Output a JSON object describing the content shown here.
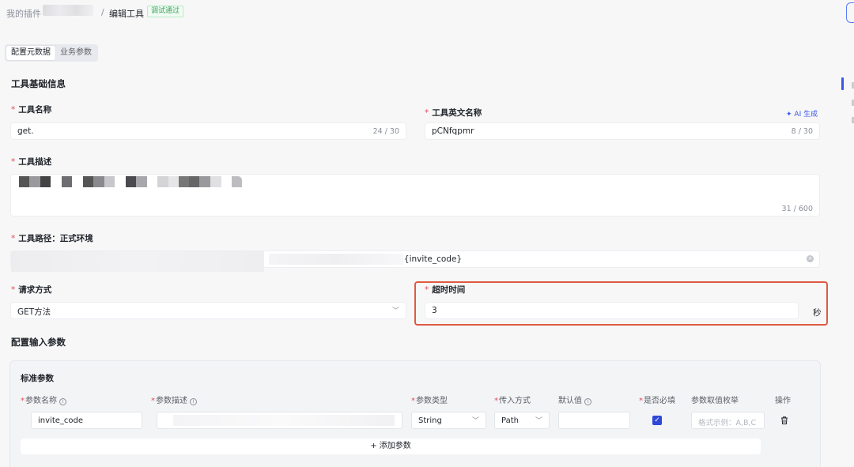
{
  "breadcrumb": {
    "root": "我的插件",
    "separator": "/",
    "current": "编辑工具",
    "status_badge": "调试通过"
  },
  "tabs": [
    {
      "label": "配置元数据",
      "active": true
    },
    {
      "label": "业务参数",
      "active": false
    }
  ],
  "basic_info": {
    "title": "工具基础信息",
    "tool_name": {
      "label": "工具名称",
      "value": "get.",
      "count": "24 / 30"
    },
    "tool_english_name": {
      "label": "工具英文名称",
      "value": "pCNfqpmr",
      "count": "8 / 30",
      "ai_generate": "AI 生成"
    },
    "tool_description": {
      "label": "工具描述",
      "count": "31 / 600"
    },
    "tool_path": {
      "label": "工具路径：正式环境",
      "value": "'{invite_code}"
    },
    "request_method": {
      "label": "请求方式",
      "value": "GET方法"
    },
    "timeout": {
      "label": "超时时间",
      "value": "3",
      "unit": "秒"
    }
  },
  "input_params": {
    "title": "配置输入参数",
    "card_title": "标准参数",
    "columns": {
      "name": "参数名称",
      "description": "参数描述",
      "type": "参数类型",
      "location": "传入方式",
      "default": "默认值",
      "required": "是否必填",
      "enum": "参数取值枚举",
      "actions": "操作"
    },
    "rows": [
      {
        "name": "invite_code",
        "type": "String",
        "location": "Path",
        "default": "",
        "required": true,
        "enum_placeholder": "格式示例：A,B,C"
      }
    ],
    "add_button": "+ 添加参数"
  },
  "colors": {
    "accent": "#3c56e8",
    "required": "#e34d59",
    "highlight_border": "#e05a43",
    "success": "#3aa35a"
  }
}
